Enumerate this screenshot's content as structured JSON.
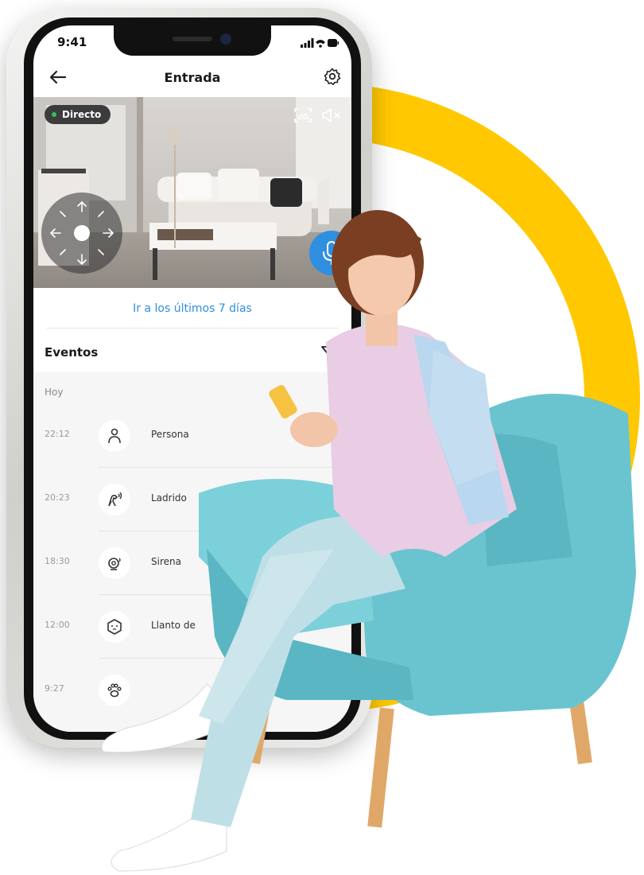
{
  "colors": {
    "ring": "#ffc800",
    "accent": "#2f8fe0",
    "chair": "#6ac4cf",
    "live_dot": "#32c35a"
  },
  "status": {
    "time": "9:41"
  },
  "header": {
    "title": "Entrada",
    "back_icon": "arrow-left-icon",
    "settings_icon": "gear-icon"
  },
  "video": {
    "live_label": "Directo",
    "icons": [
      "screenshot-icon",
      "speaker-mute-icon",
      "joystick-icon",
      "microphone-icon"
    ]
  },
  "goto_label": "Ir a los últimos 7 días",
  "events": {
    "title": "Eventos",
    "filter_icon": "filter-icon",
    "day_label": "Hoy",
    "items": [
      {
        "time": "22:12",
        "name": "Persona",
        "icon": "person-icon"
      },
      {
        "time": "20:23",
        "name": "Ladrido",
        "icon": "bark-icon"
      },
      {
        "time": "18:30",
        "name": "Sirena",
        "icon": "siren-icon"
      },
      {
        "time": "12:00",
        "name": "Llanto de",
        "icon": "baby-cry-icon"
      },
      {
        "time": "9:27",
        "name": "",
        "icon": "paw-icon"
      }
    ]
  }
}
